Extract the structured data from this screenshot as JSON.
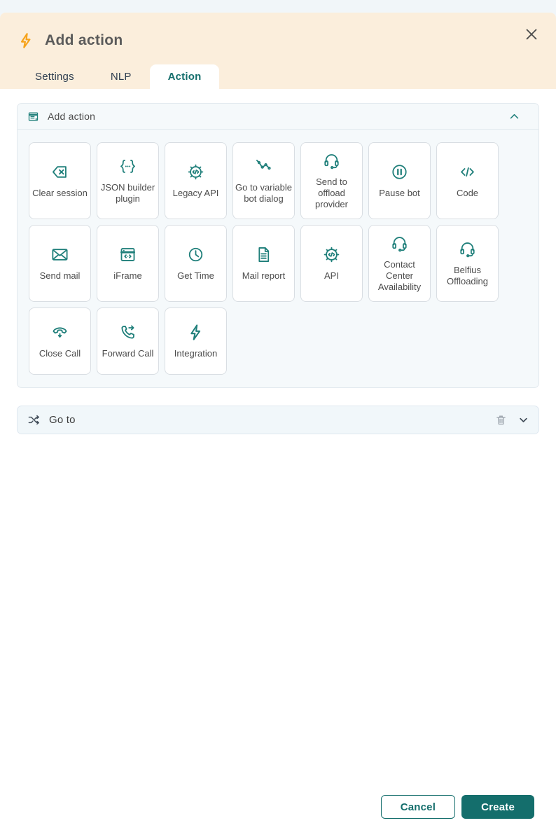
{
  "modal": {
    "title": "Add action",
    "title_icon": "lightning-bolt-icon",
    "close_icon": "close-icon",
    "colors": {
      "header_bg": "#fbeedc",
      "accent_orange": "#f6a31c",
      "accent_teal": "#146e6c",
      "icon_teal": "#1f7f7a"
    },
    "tabs": [
      {
        "label": "Settings",
        "active": false
      },
      {
        "label": "NLP",
        "active": false
      },
      {
        "label": "Action",
        "active": true
      }
    ]
  },
  "panel": {
    "title": "Add action",
    "title_icon": "form-panel-icon",
    "collapse_icon": "chevron-up-icon",
    "actions": [
      {
        "label": "Clear session",
        "icon": "clear-session-icon"
      },
      {
        "label": "JSON builder plugin",
        "icon": "json-braces-icon"
      },
      {
        "label": "Legacy API",
        "icon": "gear-code-icon"
      },
      {
        "label": "Go to variable bot dialog",
        "icon": "path-nodes-icon"
      },
      {
        "label": "Send to offload provider",
        "icon": "headset-icon"
      },
      {
        "label": "Pause bot",
        "icon": "pause-circle-icon"
      },
      {
        "label": "Code",
        "icon": "code-icon"
      },
      {
        "label": "Send mail",
        "icon": "envelope-icon"
      },
      {
        "label": "iFrame",
        "icon": "browser-code-icon"
      },
      {
        "label": "Get Time",
        "icon": "clock-icon"
      },
      {
        "label": "Mail report",
        "icon": "document-icon"
      },
      {
        "label": "API",
        "icon": "gear-code-icon"
      },
      {
        "label": "Contact Center Availability",
        "icon": "headset-icon"
      },
      {
        "label": "Belfius Offloading",
        "icon": "headset-icon"
      },
      {
        "label": "Close Call",
        "icon": "phone-down-icon"
      },
      {
        "label": "Forward Call",
        "icon": "phone-forward-icon"
      },
      {
        "label": "Integration",
        "icon": "lightning-icon"
      }
    ]
  },
  "goto_section": {
    "label": "Go to",
    "left_icon": "shuffle-icon",
    "delete_icon": "trash-icon",
    "expand_icon": "chevron-down-icon"
  },
  "footer": {
    "cancel_label": "Cancel",
    "create_label": "Create"
  }
}
